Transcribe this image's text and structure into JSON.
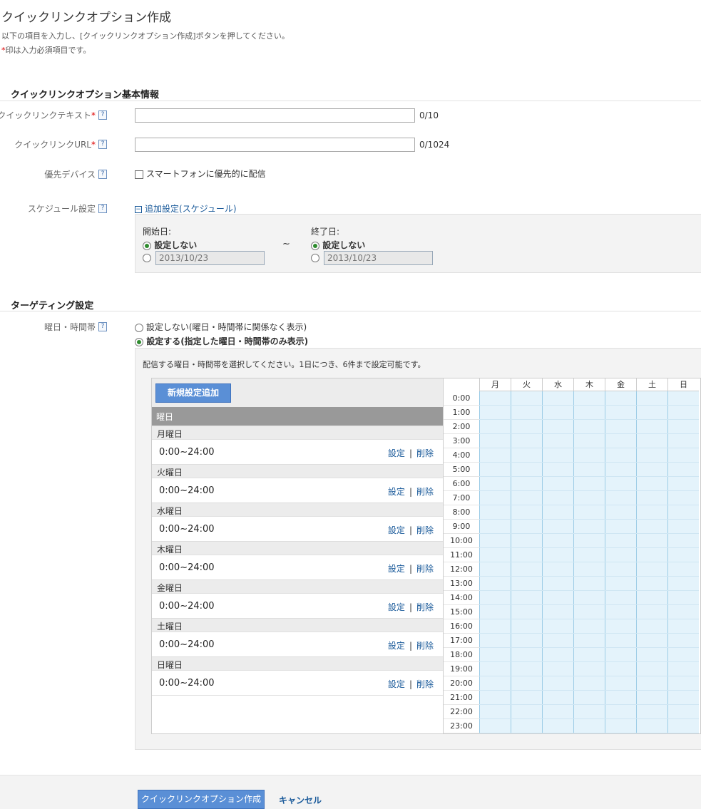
{
  "page": {
    "title": "クイックリンクオプション作成",
    "desc1": "以下の項目を入力し、[クイックリンクオプション作成]ボタンを押してください。",
    "desc2_mark": "*",
    "desc2": "印は入力必須項目です。"
  },
  "basic": {
    "heading": "クイックリンクオプション基本情報",
    "text_label": "クイックリンクテキスト",
    "text_counter": "0/10",
    "url_label": "クイックリンクURL",
    "url_counter": "0/1024",
    "device_label": "優先デバイス",
    "device_option": "スマートフォンに優先的に配信",
    "schedule_label": "スケジュール設定",
    "schedule_toggle_icon": "minus-box-icon",
    "schedule_toggle": "追加設定(スケジュール)",
    "required_mark": "*",
    "help_glyph": "?"
  },
  "schedule": {
    "start_label": "開始日:",
    "end_label": "終了日:",
    "no_setting": "設定しない",
    "start_date": "2013/10/23",
    "end_date": "2013/10/23",
    "tilde": "~"
  },
  "targeting": {
    "heading": "ターゲティング設定",
    "dayparting_label": "曜日・時間帯",
    "opt_off": "設定しない(曜日・時間帯に関係なく表示)",
    "opt_on": "設定する(指定した曜日・時間帯のみ表示)",
    "instruction": "配信する曜日・時間帯を選択してください。1日につき、6件まで設定可能です。",
    "add_button": "新規設定追加",
    "list_header": "曜日",
    "set_link": "設定",
    "delete_link": "削除",
    "separator": "|",
    "days": [
      {
        "name": "月曜日",
        "range": "0:00~24:00"
      },
      {
        "name": "火曜日",
        "range": "0:00~24:00"
      },
      {
        "name": "水曜日",
        "range": "0:00~24:00"
      },
      {
        "name": "木曜日",
        "range": "0:00~24:00"
      },
      {
        "name": "金曜日",
        "range": "0:00~24:00"
      },
      {
        "name": "土曜日",
        "range": "0:00~24:00"
      },
      {
        "name": "日曜日",
        "range": "0:00~24:00"
      }
    ],
    "grid_days": [
      "月",
      "火",
      "水",
      "木",
      "金",
      "土",
      "日"
    ],
    "hours": [
      "0:00",
      "1:00",
      "2:00",
      "3:00",
      "4:00",
      "5:00",
      "6:00",
      "7:00",
      "8:00",
      "9:00",
      "10:00",
      "11:00",
      "12:00",
      "13:00",
      "14:00",
      "15:00",
      "16:00",
      "17:00",
      "18:00",
      "19:00",
      "20:00",
      "21:00",
      "22:00",
      "23:00"
    ]
  },
  "footer": {
    "submit": "クイックリンクオプション作成",
    "cancel": "キャンセル"
  }
}
